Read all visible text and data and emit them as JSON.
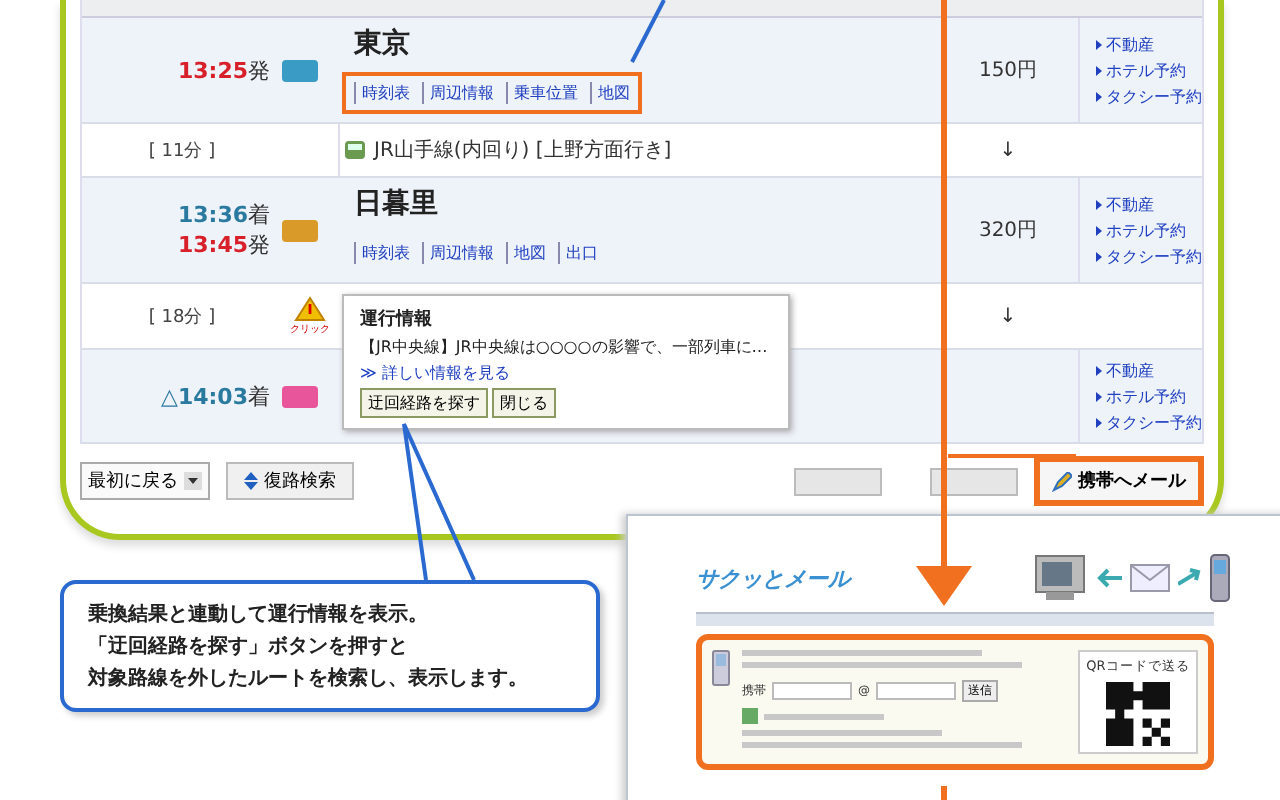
{
  "route": {
    "rows": [
      {
        "kind": "station",
        "times": [
          {
            "time": "13:25",
            "suffix": "発",
            "departure": true
          }
        ],
        "color": "#3a9cc4",
        "name": "東京",
        "links": [
          "時刻表",
          "周辺情報",
          "乗車位置",
          "地図"
        ],
        "annotated": true,
        "fare": "150円",
        "useful_links": [
          "不動産",
          "ホテル予約",
          "タクシー予約"
        ]
      },
      {
        "kind": "segment",
        "duration": "[ 11分 ]",
        "line": "JR山手線(内回り) [上野方面行き]",
        "fare": "↓"
      },
      {
        "kind": "station",
        "times": [
          {
            "time": "13:36",
            "suffix": "着",
            "departure": false
          },
          {
            "time": "13:45",
            "suffix": "発",
            "departure": true
          }
        ],
        "color": "#d99a2a",
        "name": "日暮里",
        "links": [
          "時刻表",
          "周辺情報",
          "地図",
          "出口"
        ],
        "annotated": false,
        "fare": "320円",
        "useful_links": [
          "不動産",
          "ホテル予約",
          "タクシー予約"
        ]
      },
      {
        "kind": "alert",
        "duration": "[ 18分 ]",
        "alert_label": "クリック",
        "fare": "↓",
        "popup": {
          "title": "運行情報",
          "message": "【JR中央線】JR中央線は○○○○の影響で、一部列車に…",
          "more": "≫ 詳しい情報を見る",
          "buttons": [
            "迂回経路を探す",
            "閉じる"
          ]
        }
      },
      {
        "kind": "station",
        "times": [
          {
            "time": "△14:03",
            "suffix": "着",
            "departure": false
          }
        ],
        "color": "#e8559a",
        "useful_links": [
          "不動産",
          "ホテル予約",
          "タクシー予約"
        ]
      }
    ]
  },
  "footer": {
    "select": "最初に戻る",
    "return_button": "復路検索",
    "mail_button": {
      "label": "携帯へメール",
      "annotated": true
    }
  },
  "callout": {
    "lines": [
      "乗換結果と連動して運行情報を表示。",
      "「迂回経路を探す」ボタンを押すと",
      "対象路線を外したルートを検索し、表示します。"
    ]
  },
  "mail_page": {
    "logo": "サクッとメール",
    "phone_label": "携帯",
    "at": "@",
    "send": "送信",
    "checkbox_checked": true,
    "qr_title": "QRコードで送る"
  }
}
